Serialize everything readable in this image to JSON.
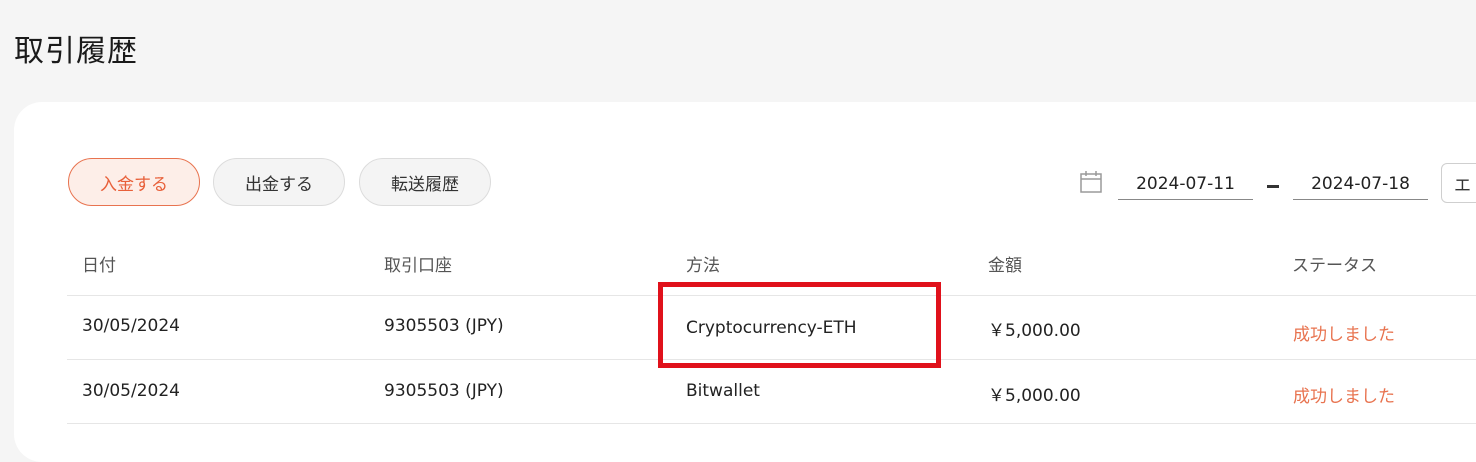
{
  "page": {
    "title": "取引履歴"
  },
  "tabs": [
    {
      "label": "入金する",
      "active": true
    },
    {
      "label": "出金する",
      "active": false
    },
    {
      "label": "転送履歴",
      "active": false
    }
  ],
  "date_range": {
    "icon": "calendar-icon",
    "start": "2024-07-11",
    "end": "2024-07-18"
  },
  "filter": {
    "visible_value": "エ"
  },
  "table": {
    "columns": [
      "日付",
      "取引口座",
      "方法",
      "金額",
      "ステータス"
    ],
    "rows": [
      {
        "date": "30/05/2024",
        "account": "9305503 (JPY)",
        "method": "Cryptocurrency-ETH",
        "amount": "￥5,000.00",
        "status": "成功しました"
      },
      {
        "date": "30/05/2024",
        "account": "9305503 (JPY)",
        "method": "Bitwallet",
        "amount": "￥5,000.00",
        "status": "成功しました"
      }
    ]
  },
  "colors": {
    "accent": "#e8734f",
    "highlight": "#e0111b"
  }
}
